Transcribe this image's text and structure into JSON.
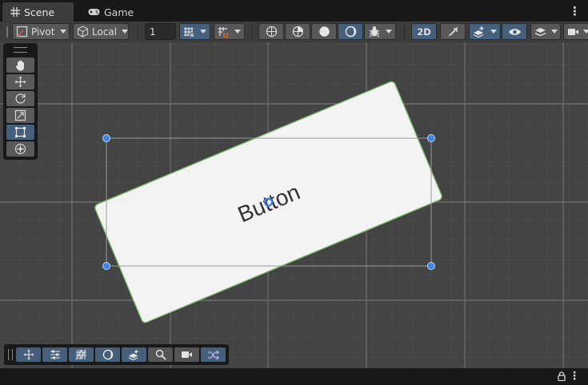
{
  "tabs": [
    {
      "label": "Scene",
      "icon": "grid-icon",
      "active": true
    },
    {
      "label": "Game",
      "icon": "gamepad-icon",
      "active": false
    }
  ],
  "toolbar": {
    "pivot_label": "Pivot",
    "local_label": "Local",
    "grid_size_value": "1",
    "mode_2d_label": "2D"
  },
  "scene": {
    "button_text": "Button",
    "button_rotation_deg": -22.7
  },
  "palette_tools": [
    "hand-tool",
    "move-tool",
    "rotate-tool",
    "scale-tool",
    "rect-tool",
    "transform-tool"
  ],
  "overlay_tools": [
    "tool-settings",
    "grid-snapping",
    "orientation",
    "search",
    "camera",
    "shuffle"
  ],
  "colors": {
    "accent": "#46607c",
    "handle": "#3e84e6",
    "selection_outline": "#7fbf6e"
  }
}
